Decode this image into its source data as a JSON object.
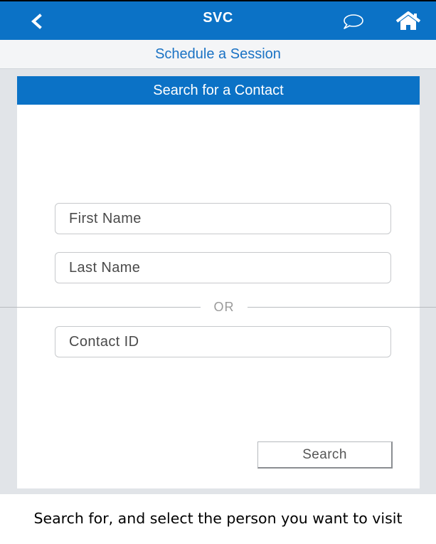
{
  "app": {
    "title": "SVC"
  },
  "page": {
    "subtitle": "Schedule a Session"
  },
  "card": {
    "title": "Search for a Contact",
    "first_name_placeholder": "First Name",
    "last_name_placeholder": "Last Name",
    "or_label": "OR",
    "contact_id_placeholder": "Contact ID",
    "search_label": "Search"
  },
  "caption": "Search for, and select the person you want to visit",
  "icons": {
    "back": "chevron-left-icon",
    "chat": "chat-bubble-icon",
    "home": "home-icon"
  },
  "colors": {
    "primary": "#0b72c6",
    "link": "#1a72c4",
    "background": "#e1e4e8"
  }
}
